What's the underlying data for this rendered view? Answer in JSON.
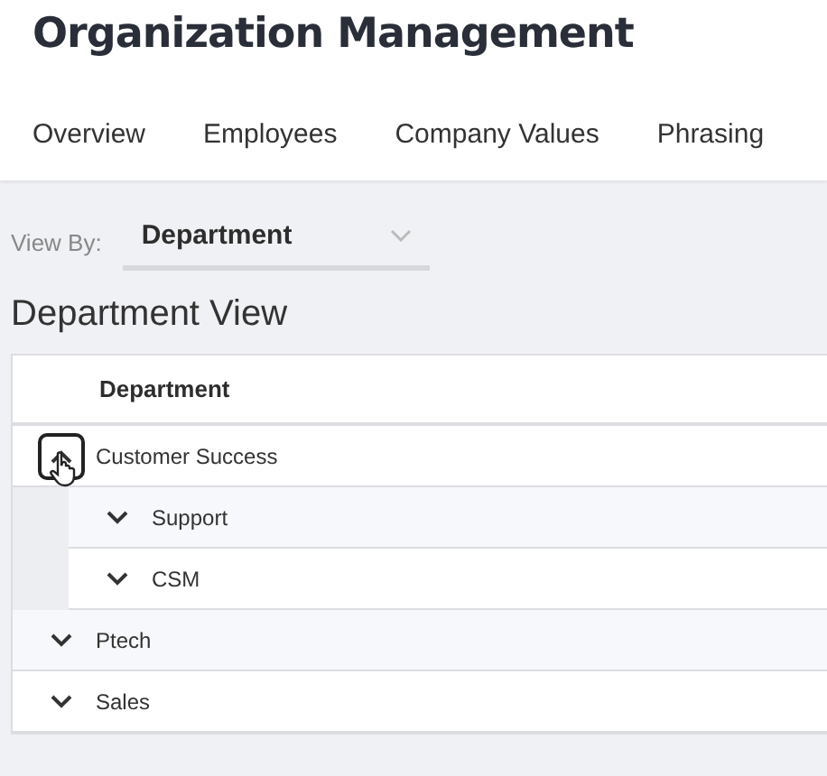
{
  "title": "Organization Management",
  "tabs": [
    {
      "label": "Overview"
    },
    {
      "label": "Employees"
    },
    {
      "label": "Company Values"
    },
    {
      "label": "Phrasing"
    }
  ],
  "view_by": {
    "label": "View By:",
    "value": "Department"
  },
  "section_title": "Department View",
  "table": {
    "columns": [
      "Department"
    ],
    "rows": [
      {
        "name": "Customer Success",
        "expanded": true,
        "focused": true,
        "children": [
          {
            "name": "Support",
            "expanded": false
          },
          {
            "name": "CSM",
            "expanded": false
          }
        ]
      },
      {
        "name": "Ptech",
        "expanded": false,
        "focused": false
      },
      {
        "name": "Sales",
        "expanded": false,
        "focused": false
      }
    ]
  }
}
